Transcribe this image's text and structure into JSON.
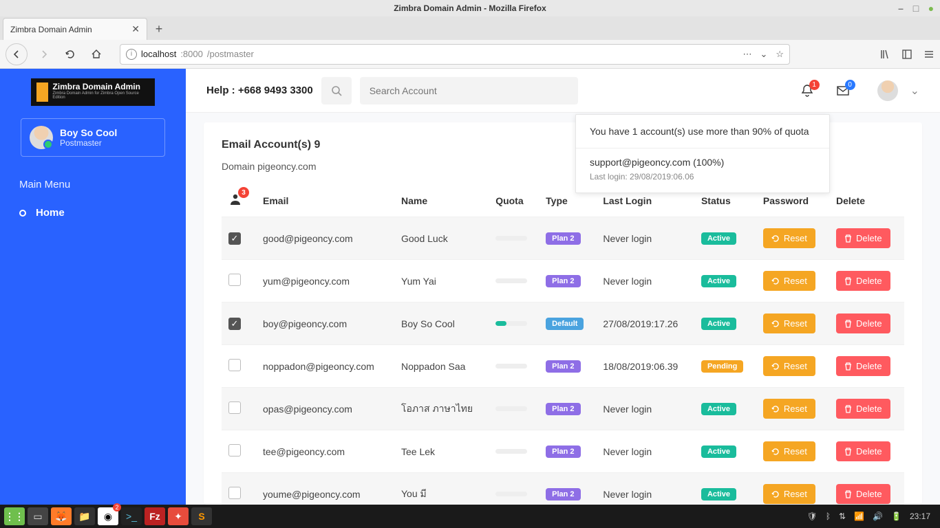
{
  "window": {
    "title": "Zimbra Domain Admin - Mozilla Firefox"
  },
  "browser": {
    "tab_title": "Zimbra Domain Admin",
    "url_host": "localhost",
    "url_port": ":8000",
    "url_path": "/postmaster"
  },
  "sidebar": {
    "logo_title": "Zimbra Domain Admin",
    "logo_sub": "Zimbra Domain Admin for Zimbra Open Source Edition",
    "user_name": "Boy So Cool",
    "user_role": "Postmaster",
    "menu_header": "Main Menu",
    "home_label": "Home"
  },
  "topbar": {
    "help_text": "Help : +668 9493 3300",
    "search_placeholder": "Search Account",
    "bell_badge": "1",
    "mail_badge": "0"
  },
  "popover": {
    "heading": "You have 1 account(s) use more than 90% of quota",
    "item_title": "support@pigeoncy.com (100%)",
    "item_sub": "Last login: 29/08/2019:06.06"
  },
  "content": {
    "title_prefix": "Email Account(s) ",
    "count": "9",
    "domain_prefix": "Domain ",
    "domain": "pigeoncy.com",
    "person_badge": "3",
    "headers": {
      "email": "Email",
      "name": "Name",
      "quota": "Quota",
      "type": "Type",
      "last_login": "Last Login",
      "status": "Status",
      "password": "Password",
      "delete": "Delete"
    },
    "reset_label": "Reset",
    "delete_label": "Delete",
    "rows": [
      {
        "checked": true,
        "email": "good@pigeoncy.com",
        "name": "Good Luck",
        "quota_pct": 0,
        "type": "Plan 2",
        "type_class": "plan2",
        "last_login": "Never login",
        "status": "Active",
        "status_class": "active"
      },
      {
        "checked": false,
        "email": "yum@pigeoncy.com",
        "name": "Yum Yai",
        "quota_pct": 0,
        "type": "Plan 2",
        "type_class": "plan2",
        "last_login": "Never login",
        "status": "Active",
        "status_class": "active"
      },
      {
        "checked": true,
        "email": "boy@pigeoncy.com",
        "name": "Boy So Cool",
        "quota_pct": 35,
        "type": "Default",
        "type_class": "default",
        "last_login": "27/08/2019:17.26",
        "status": "Active",
        "status_class": "active"
      },
      {
        "checked": false,
        "email": "noppadon@pigeoncy.com",
        "name": "Noppadon Saa",
        "quota_pct": 0,
        "type": "Plan 2",
        "type_class": "plan2",
        "last_login": "18/08/2019:06.39",
        "status": "Pending",
        "status_class": "pending"
      },
      {
        "checked": false,
        "email": "opas@pigeoncy.com",
        "name": "โอภาส ภาษาไทย",
        "quota_pct": 0,
        "type": "Plan 2",
        "type_class": "plan2",
        "last_login": "Never login",
        "status": "Active",
        "status_class": "active"
      },
      {
        "checked": false,
        "email": "tee@pigeoncy.com",
        "name": "Tee Lek",
        "quota_pct": 0,
        "type": "Plan 2",
        "type_class": "plan2",
        "last_login": "Never login",
        "status": "Active",
        "status_class": "active"
      },
      {
        "checked": false,
        "email": "youme@pigeoncy.com",
        "name": "You มี",
        "quota_pct": 0,
        "type": "Plan 2",
        "type_class": "plan2",
        "last_login": "Never login",
        "status": "Active",
        "status_class": "active"
      }
    ]
  },
  "taskbar": {
    "chrome_badge": "2",
    "time": "23:17"
  }
}
